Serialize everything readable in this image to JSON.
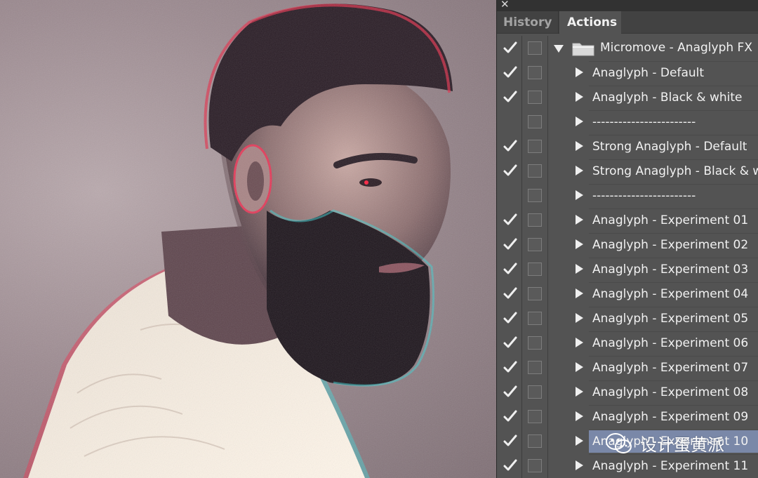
{
  "panel": {
    "close_glyph": "✕",
    "tabs": [
      {
        "label": "History",
        "active": false
      },
      {
        "label": "Actions",
        "active": true
      }
    ],
    "rows": [
      {
        "checked": true,
        "expanded": true,
        "is_set": true,
        "selected": false,
        "label": "Micromove - Anaglyph FX"
      },
      {
        "checked": true,
        "expanded": false,
        "is_set": false,
        "selected": false,
        "label": "Anaglyph - Default"
      },
      {
        "checked": true,
        "expanded": false,
        "is_set": false,
        "selected": false,
        "label": "Anaglyph - Black & white"
      },
      {
        "checked": false,
        "expanded": false,
        "is_set": false,
        "selected": false,
        "label": "------------------------"
      },
      {
        "checked": true,
        "expanded": false,
        "is_set": false,
        "selected": false,
        "label": "Strong Anaglyph - Default"
      },
      {
        "checked": true,
        "expanded": false,
        "is_set": false,
        "selected": false,
        "label": "Strong Anaglyph - Black & w"
      },
      {
        "checked": false,
        "expanded": false,
        "is_set": false,
        "selected": false,
        "label": "------------------------"
      },
      {
        "checked": true,
        "expanded": false,
        "is_set": false,
        "selected": false,
        "label": "Anaglyph - Experiment 01"
      },
      {
        "checked": true,
        "expanded": false,
        "is_set": false,
        "selected": false,
        "label": "Anaglyph - Experiment 02"
      },
      {
        "checked": true,
        "expanded": false,
        "is_set": false,
        "selected": false,
        "label": "Anaglyph - Experiment 03"
      },
      {
        "checked": true,
        "expanded": false,
        "is_set": false,
        "selected": false,
        "label": "Anaglyph - Experiment 04"
      },
      {
        "checked": true,
        "expanded": false,
        "is_set": false,
        "selected": false,
        "label": "Anaglyph - Experiment 05"
      },
      {
        "checked": true,
        "expanded": false,
        "is_set": false,
        "selected": false,
        "label": "Anaglyph - Experiment 06"
      },
      {
        "checked": true,
        "expanded": false,
        "is_set": false,
        "selected": false,
        "label": "Anaglyph - Experiment 07"
      },
      {
        "checked": true,
        "expanded": false,
        "is_set": false,
        "selected": false,
        "label": "Anaglyph - Experiment 08"
      },
      {
        "checked": true,
        "expanded": false,
        "is_set": false,
        "selected": false,
        "label": "Anaglyph - Experiment 09"
      },
      {
        "checked": true,
        "expanded": false,
        "is_set": false,
        "selected": true,
        "label": "Anaglyph - Experiment 10"
      },
      {
        "checked": true,
        "expanded": false,
        "is_set": false,
        "selected": false,
        "label": "Anaglyph - Experiment 11"
      }
    ],
    "selected_color": "#7a88a8",
    "background_color": "#535353"
  },
  "watermark": {
    "icon": "wechat-icon",
    "text": "设计蛋黄派"
  }
}
